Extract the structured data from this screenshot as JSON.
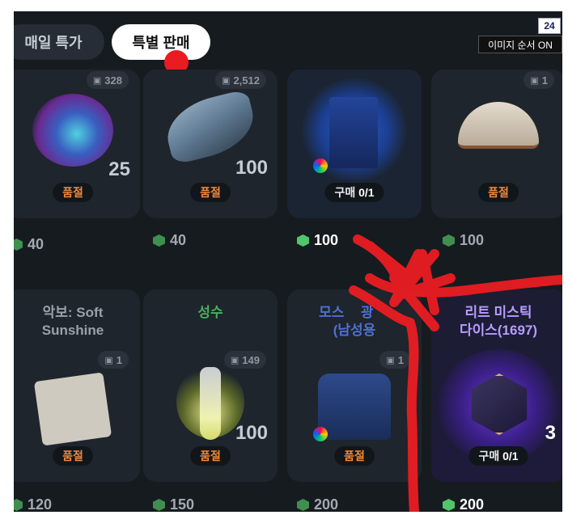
{
  "tabs": {
    "daily": "매일 특가",
    "special": "특별 판매"
  },
  "overlay": {
    "number": "24",
    "image_order": "이미지 순서 ON"
  },
  "colors": {
    "background": "#161b20",
    "soldout": "#f08a3e",
    "gem": "#52c46a",
    "annotation": "#ea1c22",
    "rare_title": "#b79cff",
    "title_green": "#49b05b",
    "title_blue": "#4f6fd6"
  },
  "row1": [
    {
      "count": "328",
      "qty": "25",
      "status": "품절",
      "price": "40",
      "icon": "magic-orb-icon"
    },
    {
      "count": "2,512",
      "qty": "100",
      "status": "품절",
      "price": "40",
      "icon": "wing-icon"
    },
    {
      "count": "",
      "qty": "",
      "status_label": "구매",
      "status_value": "0/1",
      "price": "100",
      "icon": "wallpaper-item-icon"
    },
    {
      "count": "1",
      "qty": "",
      "status": "품절",
      "price": "100",
      "icon": "handbag-icon"
    }
  ],
  "row2": [
    {
      "title": "악보: Soft\nSunshine",
      "count": "1",
      "qty": "",
      "status": "품절",
      "price": "120",
      "icon": "sheet-music-icon"
    },
    {
      "title": "성수",
      "count": "149",
      "qty": "100",
      "status": "품절",
      "price": "150",
      "icon": "potion-bottle-icon"
    },
    {
      "title": "모스 ᅟ광 ᅟ\n(남성용",
      "count": "1",
      "qty": "",
      "status": "품절",
      "price": "200",
      "icon": "jacket-icon"
    },
    {
      "title": "리트 미스틱\n다이스(1697)",
      "count": "",
      "qty": "3",
      "status_label": "구매",
      "status_value": "0/1",
      "price": "200",
      "icon": "mystic-dice-icon"
    }
  ]
}
